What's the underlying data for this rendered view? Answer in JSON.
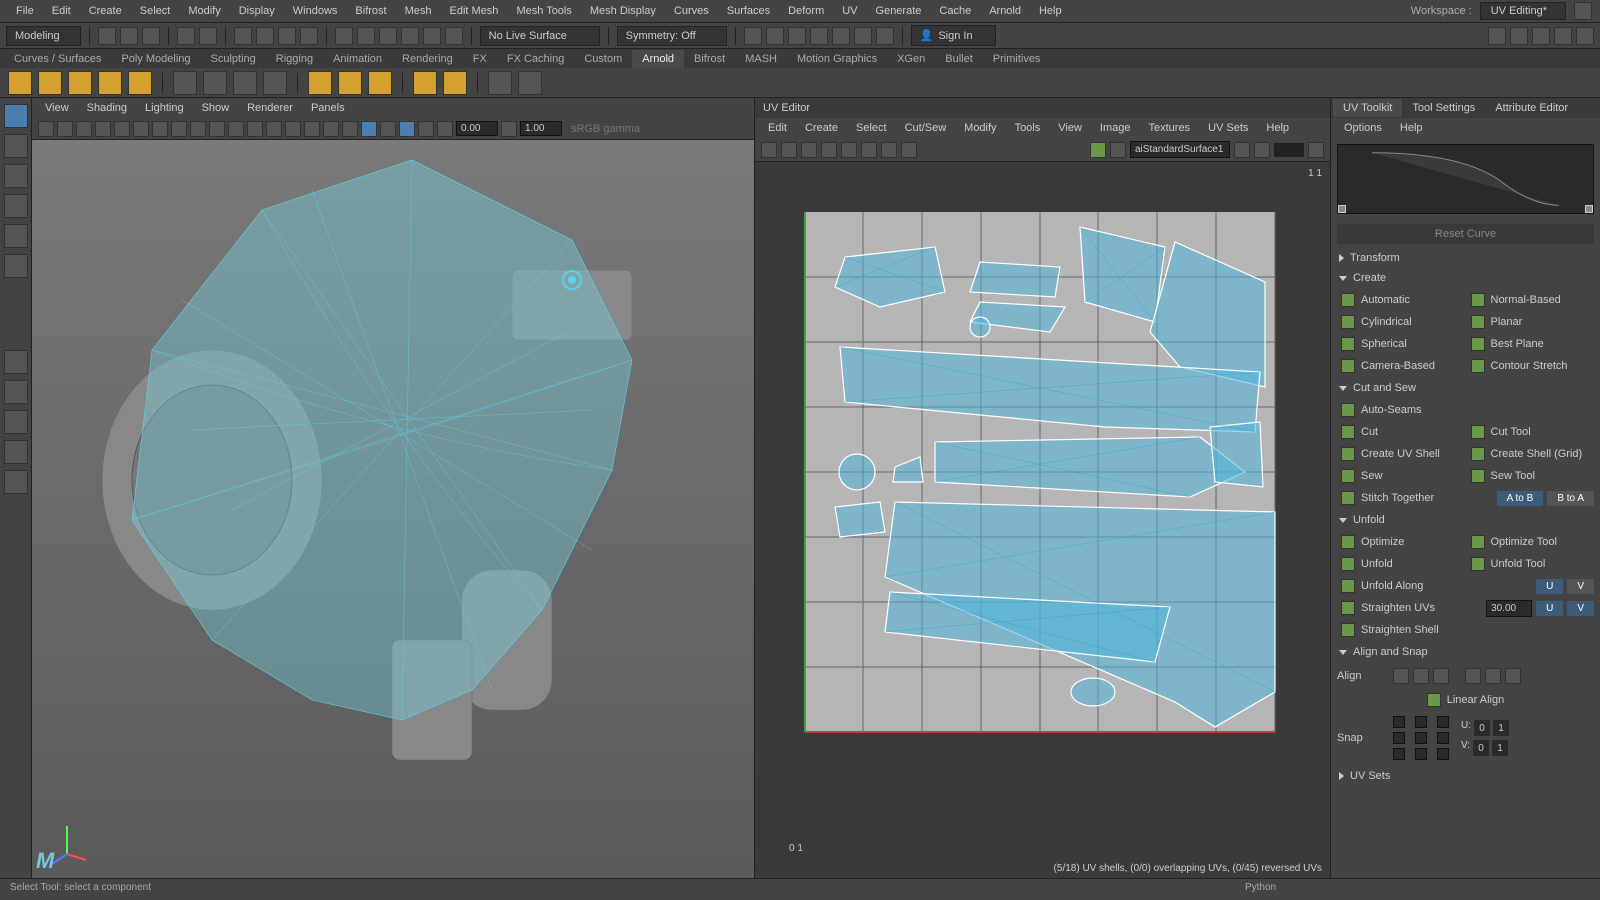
{
  "menu": [
    "File",
    "Edit",
    "Create",
    "Select",
    "Modify",
    "Display",
    "Windows",
    "Bifrost",
    "Mesh",
    "Edit Mesh",
    "Mesh Tools",
    "Mesh Display",
    "Curves",
    "Surfaces",
    "Deform",
    "UV",
    "Generate",
    "Cache",
    "Arnold",
    "Help"
  ],
  "workspace": {
    "label": "Workspace :",
    "value": "UV Editing*"
  },
  "mode": "Modeling",
  "surface_mode": "No Live Surface",
  "symmetry": "Symmetry: Off",
  "signin": "Sign In",
  "shelf_tabs": [
    "Curves / Surfaces",
    "Poly Modeling",
    "Sculpting",
    "Rigging",
    "Animation",
    "Rendering",
    "FX",
    "FX Caching",
    "Custom",
    "Arnold",
    "Bifrost",
    "MASH",
    "Motion Graphics",
    "XGen",
    "Bullet",
    "Primitives"
  ],
  "shelf_active": "Arnold",
  "viewport": {
    "menu": [
      "View",
      "Shading",
      "Lighting",
      "Show",
      "Renderer",
      "Panels"
    ],
    "exposure": "0.00",
    "gamma": "1.00",
    "colorspace": "sRGB gamma"
  },
  "uv_editor": {
    "title": "UV Editor",
    "menu": [
      "Edit",
      "Create",
      "Select",
      "Cut/Sew",
      "Modify",
      "Tools",
      "View",
      "Image",
      "Textures",
      "UV Sets",
      "Help"
    ],
    "material": "aiStandardSurface1",
    "stats": "(5/18) UV shells, (0/0) overlapping UVs, (0/45) reversed UVs",
    "coord_top": "1 1",
    "coord_bottom": "0 1"
  },
  "toolkit": {
    "tabs": [
      "UV Toolkit",
      "Tool Settings",
      "Attribute Editor"
    ],
    "active_tab": "UV Toolkit",
    "menu": [
      "Options",
      "Help"
    ],
    "reset": "Reset Curve",
    "sections": {
      "transform": "Transform",
      "create": "Create",
      "cutsew": "Cut and Sew",
      "unfold": "Unfold",
      "align": "Align and Snap",
      "uvsets": "UV Sets"
    },
    "create_btns": [
      "Automatic",
      "Normal-Based",
      "Cylindrical",
      "Planar",
      "Spherical",
      "Best Plane",
      "Camera-Based",
      "Contour Stretch"
    ],
    "cutsew": {
      "autoseams": "Auto-Seams",
      "cut": "Cut",
      "cuttool": "Cut Tool",
      "createshell": "Create UV Shell",
      "createshellgrid": "Create Shell (Grid)",
      "sew": "Sew",
      "sewtool": "Sew Tool",
      "stitch": "Stitch Together",
      "atob": "A to B",
      "btoa": "B to A"
    },
    "unfold": {
      "optimize": "Optimize",
      "optimizetool": "Optimize Tool",
      "unfold": "Unfold",
      "unfoldtool": "Unfold Tool",
      "unfoldalong": "Unfold Along",
      "u": "U",
      "v": "V",
      "straighten": "Straighten UVs",
      "straighten_val": "30.00",
      "straightenshell": "Straighten Shell"
    },
    "align": {
      "label": "Align",
      "linear": "Linear Align",
      "snap": "Snap",
      "u_label": "U:",
      "v_label": "V:",
      "u0": "0",
      "u1": "1",
      "v0": "0",
      "v1": "1"
    }
  },
  "status": {
    "hint": "Select Tool: select a component",
    "script": "Python"
  }
}
